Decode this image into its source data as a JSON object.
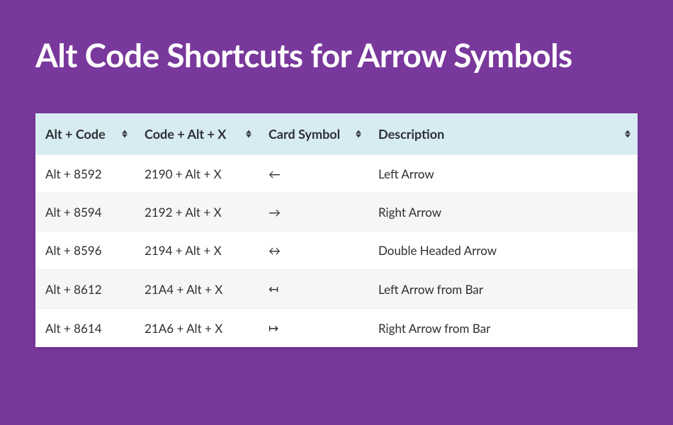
{
  "title": "Alt Code Shortcuts for Arrow Symbols",
  "table": {
    "headers": {
      "altCode": "Alt + Code",
      "hexCode": "Code + Alt + X",
      "symbol": "Card Symbol",
      "description": "Description"
    },
    "rows": [
      {
        "altCode": "Alt + 8592",
        "hexCode": "2190 + Alt + X",
        "symbol": "←",
        "description": "Left Arrow"
      },
      {
        "altCode": "Alt + 8594",
        "hexCode": "2192 + Alt + X",
        "symbol": "→",
        "description": "Right Arrow"
      },
      {
        "altCode": "Alt + 8596",
        "hexCode": "2194 + Alt + X",
        "symbol": "↔",
        "description": "Double Headed Arrow"
      },
      {
        "altCode": "Alt + 8612",
        "hexCode": "21A4 + Alt + X",
        "symbol": "↤",
        "description": "Left Arrow from Bar"
      },
      {
        "altCode": "Alt + 8614",
        "hexCode": "21A6 + Alt + X",
        "symbol": "↦",
        "description": "Right Arrow from Bar"
      }
    ]
  }
}
